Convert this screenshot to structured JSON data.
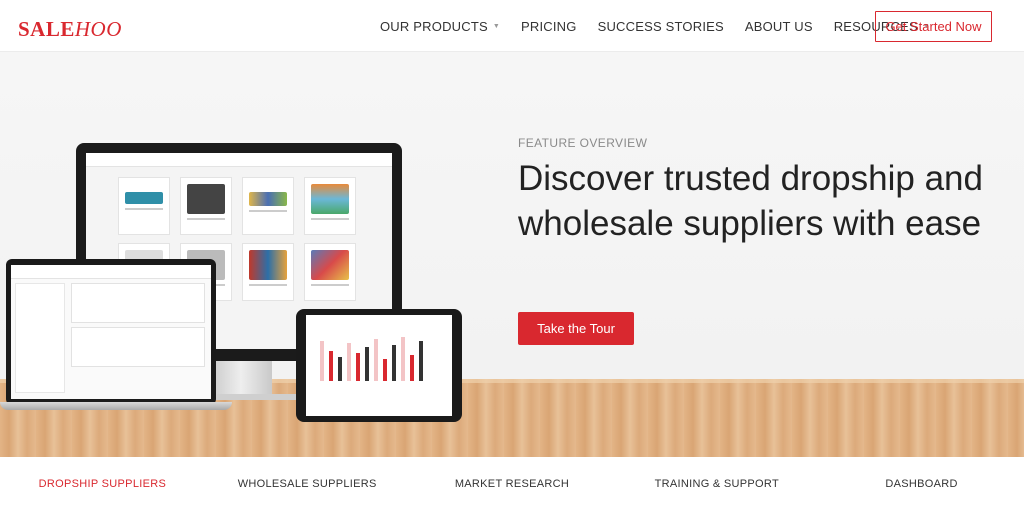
{
  "brand": {
    "logo_part1": "SALE",
    "logo_part2": "HOO",
    "accent": "#d9282f"
  },
  "nav": {
    "items": [
      {
        "label": "OUR PRODUCTS",
        "has_dropdown": true
      },
      {
        "label": "PRICING",
        "has_dropdown": false
      },
      {
        "label": "SUCCESS STORIES",
        "has_dropdown": false
      },
      {
        "label": "ABOUT US",
        "has_dropdown": false
      },
      {
        "label": "RESOURCES",
        "has_dropdown": true
      }
    ],
    "cta": "Get Started Now"
  },
  "hero": {
    "eyebrow": "FEATURE OVERVIEW",
    "headline": "Discover trusted dropship and wholesale suppliers with ease",
    "button": "Take the Tour"
  },
  "tabs": [
    {
      "label": "DROPSHIP SUPPLIERS",
      "active": true
    },
    {
      "label": "WHOLESALE SUPPLIERS",
      "active": false
    },
    {
      "label": "MARKET RESEARCH",
      "active": false
    },
    {
      "label": "TRAINING & SUPPORT",
      "active": false
    },
    {
      "label": "DASHBOARD",
      "active": false
    }
  ]
}
